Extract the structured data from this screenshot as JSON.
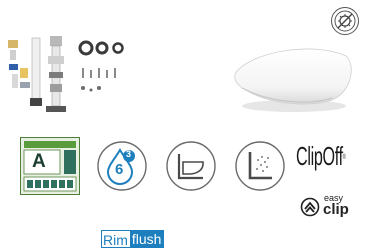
{
  "images": {
    "parts_kit": "fitting-parts-kit",
    "seat": "toilet-seat-lid",
    "seal": "antibacterial-seal-icon"
  },
  "energy_label": {
    "grade": "A"
  },
  "icons": [
    {
      "name": "water-drop-6-3-icon",
      "text_big": "6",
      "text_small": "3"
    },
    {
      "name": "wall-hung-toilet-icon"
    },
    {
      "name": "spray-flush-icon"
    }
  ],
  "clipoff": {
    "label": "ClipOff",
    "mark": "®"
  },
  "easyclip": {
    "line1": "easy",
    "line2": "clip"
  },
  "rimflush": {
    "part1": "Rim",
    "part2": "flush"
  },
  "colors": {
    "accent_blue": "#1d7fbd",
    "energy_green": "#5a9b3c",
    "energy_teal": "#2e6f5e"
  }
}
